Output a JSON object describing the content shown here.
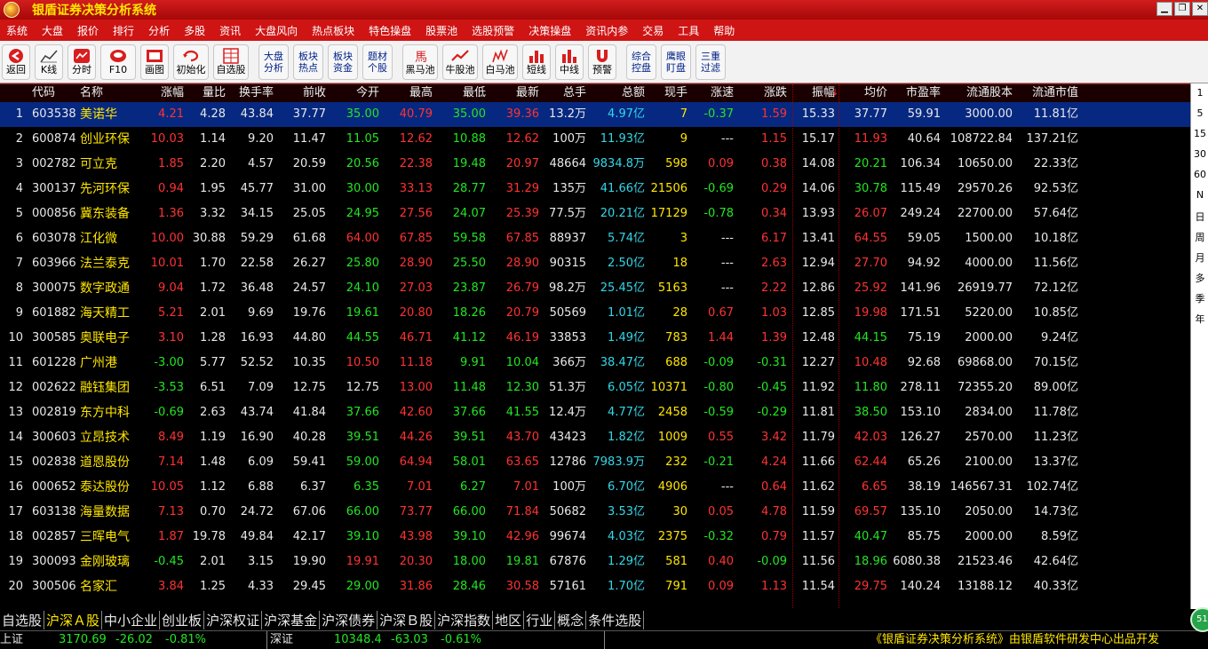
{
  "window": {
    "title": "银盾证券决策分析系统"
  },
  "menu": [
    "系统",
    "大盘",
    "报价",
    "排行",
    "分析",
    "多股",
    "资讯",
    "大盘风向",
    "热点板块",
    "特色操盘",
    "股票池",
    "选股预警",
    "决策操盘",
    "资讯内参",
    "交易",
    "工具",
    "帮助"
  ],
  "toolbar": [
    {
      "label": "返回",
      "icon": "back-icon"
    },
    {
      "label": "K线",
      "icon": "kline-icon"
    },
    {
      "label": "分时",
      "icon": "intraday-icon"
    },
    {
      "label": "F10",
      "icon": "f10-icon"
    },
    {
      "label": "画图",
      "icon": "draw-icon"
    },
    {
      "label": "初始化",
      "icon": "reset-icon"
    },
    {
      "label": "自选股",
      "icon": "watchlist-icon"
    },
    {
      "label1": "大盘",
      "label2": "分析"
    },
    {
      "label1": "板块",
      "label2": "热点"
    },
    {
      "label1": "板块",
      "label2": "资金"
    },
    {
      "label1": "题材",
      "label2": "个股"
    },
    {
      "label": "黑马池",
      "icon": "horse-icon"
    },
    {
      "label": "牛股池",
      "icon": "bull-icon"
    },
    {
      "label": "白马池",
      "icon": "whitehorse-icon"
    },
    {
      "label": "短线",
      "icon": "short-bars-icon"
    },
    {
      "label": "中线",
      "icon": "mid-bars-icon"
    },
    {
      "label": "预警",
      "icon": "alert-magnet-icon"
    },
    {
      "label1": "综合",
      "label2": "控盘"
    },
    {
      "label1": "鹰眼",
      "label2": "盯盘"
    },
    {
      "label1": "三重",
      "label2": "过滤"
    }
  ],
  "columns": [
    "代码",
    "名称",
    "涨幅",
    "量比",
    "换手率",
    "前收",
    "今开",
    "最高",
    "最低",
    "最新",
    "总手",
    "总额",
    "现手",
    "涨速",
    "涨跌",
    "振幅",
    "均价",
    "市盈率",
    "流通股本",
    "流通市值"
  ],
  "sort_indicator": "↓",
  "rows": [
    [
      "1",
      "603538",
      "美诺华",
      "4.21",
      "4.28",
      "43.84",
      "37.77",
      "35.00",
      "40.79",
      "35.00",
      "39.36",
      "13.2万",
      "4.97亿",
      "7",
      "-0.37",
      "1.59",
      "15.33",
      "37.77",
      "59.91",
      "3000.00",
      "11.81亿"
    ],
    [
      "2",
      "600874",
      "创业环保",
      "10.03",
      "1.14",
      "9.20",
      "11.47",
      "11.05",
      "12.62",
      "10.88",
      "12.62",
      "100万",
      "11.93亿",
      "9",
      "---",
      "1.15",
      "15.17",
      "11.93",
      "40.64",
      "108722.84",
      "137.21亿"
    ],
    [
      "3",
      "002782",
      "可立克",
      "1.85",
      "2.20",
      "4.57",
      "20.59",
      "20.56",
      "22.38",
      "19.48",
      "20.97",
      "48664",
      "9834.8万",
      "598",
      "0.09",
      "0.38",
      "14.08",
      "20.21",
      "106.34",
      "10650.00",
      "22.33亿"
    ],
    [
      "4",
      "300137",
      "先河环保",
      "0.94",
      "1.95",
      "45.77",
      "31.00",
      "30.00",
      "33.13",
      "28.77",
      "31.29",
      "135万",
      "41.66亿",
      "21506",
      "-0.69",
      "0.29",
      "14.06",
      "30.78",
      "115.49",
      "29570.26",
      "92.53亿"
    ],
    [
      "5",
      "000856",
      "冀东装备",
      "1.36",
      "3.32",
      "34.15",
      "25.05",
      "24.95",
      "27.56",
      "24.07",
      "25.39",
      "77.5万",
      "20.21亿",
      "17129",
      "-0.78",
      "0.34",
      "13.93",
      "26.07",
      "249.24",
      "22700.00",
      "57.64亿"
    ],
    [
      "6",
      "603078",
      "江化微",
      "10.00",
      "30.88",
      "59.29",
      "61.68",
      "64.00",
      "67.85",
      "59.58",
      "67.85",
      "88937",
      "5.74亿",
      "3",
      "---",
      "6.17",
      "13.41",
      "64.55",
      "59.05",
      "1500.00",
      "10.18亿"
    ],
    [
      "7",
      "603966",
      "法兰泰克",
      "10.01",
      "1.70",
      "22.58",
      "26.27",
      "25.80",
      "28.90",
      "25.50",
      "28.90",
      "90315",
      "2.50亿",
      "18",
      "---",
      "2.63",
      "12.94",
      "27.70",
      "94.92",
      "4000.00",
      "11.56亿"
    ],
    [
      "8",
      "300075",
      "数字政通",
      "9.04",
      "1.72",
      "36.48",
      "24.57",
      "24.10",
      "27.03",
      "23.87",
      "26.79",
      "98.2万",
      "25.45亿",
      "5163",
      "---",
      "2.22",
      "12.86",
      "25.92",
      "141.96",
      "26919.77",
      "72.12亿"
    ],
    [
      "9",
      "601882",
      "海天精工",
      "5.21",
      "2.01",
      "9.69",
      "19.76",
      "19.61",
      "20.80",
      "18.26",
      "20.79",
      "50569",
      "1.01亿",
      "28",
      "0.67",
      "1.03",
      "12.85",
      "19.98",
      "171.51",
      "5220.00",
      "10.85亿"
    ],
    [
      "10",
      "300585",
      "奥联电子",
      "3.10",
      "1.28",
      "16.93",
      "44.80",
      "44.55",
      "46.71",
      "41.12",
      "46.19",
      "33853",
      "1.49亿",
      "783",
      "1.44",
      "1.39",
      "12.48",
      "44.15",
      "75.19",
      "2000.00",
      "9.24亿"
    ],
    [
      "11",
      "601228",
      "广州港",
      "-3.00",
      "5.77",
      "52.52",
      "10.35",
      "10.50",
      "11.18",
      "9.91",
      "10.04",
      "366万",
      "38.47亿",
      "688",
      "-0.09",
      "-0.31",
      "12.27",
      "10.48",
      "92.68",
      "69868.00",
      "70.15亿"
    ],
    [
      "12",
      "002622",
      "融钰集团",
      "-3.53",
      "6.51",
      "7.09",
      "12.75",
      "12.75",
      "13.00",
      "11.48",
      "12.30",
      "51.3万",
      "6.05亿",
      "10371",
      "-0.80",
      "-0.45",
      "11.92",
      "11.80",
      "278.11",
      "72355.20",
      "89.00亿"
    ],
    [
      "13",
      "002819",
      "东方中科",
      "-0.69",
      "2.63",
      "43.74",
      "41.84",
      "37.66",
      "42.60",
      "37.66",
      "41.55",
      "12.4万",
      "4.77亿",
      "2458",
      "-0.59",
      "-0.29",
      "11.81",
      "38.50",
      "153.10",
      "2834.00",
      "11.78亿"
    ],
    [
      "14",
      "300603",
      "立昂技术",
      "8.49",
      "1.19",
      "16.90",
      "40.28",
      "39.51",
      "44.26",
      "39.51",
      "43.70",
      "43423",
      "1.82亿",
      "1009",
      "0.55",
      "3.42",
      "11.79",
      "42.03",
      "126.27",
      "2570.00",
      "11.23亿"
    ],
    [
      "15",
      "002838",
      "道恩股份",
      "7.14",
      "1.48",
      "6.09",
      "59.41",
      "59.00",
      "64.94",
      "58.01",
      "63.65",
      "12786",
      "7983.9万",
      "232",
      "-0.21",
      "4.24",
      "11.66",
      "62.44",
      "65.26",
      "2100.00",
      "13.37亿"
    ],
    [
      "16",
      "000652",
      "泰达股份",
      "10.05",
      "1.12",
      "6.88",
      "6.37",
      "6.35",
      "7.01",
      "6.27",
      "7.01",
      "100万",
      "6.70亿",
      "4906",
      "---",
      "0.64",
      "11.62",
      "6.65",
      "38.19",
      "146567.31",
      "102.74亿"
    ],
    [
      "17",
      "603138",
      "海量数据",
      "7.13",
      "0.70",
      "24.72",
      "67.06",
      "66.00",
      "73.77",
      "66.00",
      "71.84",
      "50682",
      "3.53亿",
      "30",
      "0.05",
      "4.78",
      "11.59",
      "69.57",
      "135.10",
      "2050.00",
      "14.73亿"
    ],
    [
      "18",
      "002857",
      "三晖电气",
      "1.87",
      "19.78",
      "49.84",
      "42.17",
      "39.10",
      "43.98",
      "39.10",
      "42.96",
      "99674",
      "4.03亿",
      "2375",
      "-0.32",
      "0.79",
      "11.57",
      "40.47",
      "85.75",
      "2000.00",
      "8.59亿"
    ],
    [
      "19",
      "300093",
      "金刚玻璃",
      "-0.45",
      "2.01",
      "3.15",
      "19.90",
      "19.91",
      "20.30",
      "18.00",
      "19.81",
      "67876",
      "1.29亿",
      "581",
      "0.40",
      "-0.09",
      "11.56",
      "18.96",
      "6080.38",
      "21523.46",
      "42.64亿"
    ],
    [
      "20",
      "300506",
      "名家汇",
      "3.84",
      "1.25",
      "4.33",
      "29.45",
      "29.00",
      "31.86",
      "28.46",
      "30.58",
      "57161",
      "1.70亿",
      "791",
      "0.09",
      "1.13",
      "11.54",
      "29.75",
      "140.24",
      "13188.12",
      "40.33亿"
    ]
  ],
  "period_buttons": [
    "1",
    "5",
    "15",
    "30",
    "60",
    "N",
    "日",
    "周",
    "月",
    "多",
    "季",
    "年"
  ],
  "bottom_tabs": [
    "自选股",
    "沪深Ａ股",
    "中小企业",
    "创业板",
    "沪深权证",
    "沪深基金",
    "沪深债券",
    "沪深Ｂ股",
    "沪深指数",
    "地区",
    "行业",
    "概念",
    "条件选股"
  ],
  "active_tab": 1,
  "status": {
    "sh_label": "上证",
    "sh_value": "3170.69",
    "sh_change": "-26.02",
    "sh_pct": "-0.81%",
    "sz_label": "深证",
    "sz_value": "10348.4",
    "sz_change": "-63.03",
    "sz_pct": "-0.61%",
    "ticker": "《银盾证券决策分析系统》由银盾软件研发中心出品开发"
  },
  "badge": "51",
  "colors": {
    "up": "#ff3232",
    "down": "#22e622",
    "flat": "#e8e8e8",
    "name": "#ffe600",
    "amount": "#33d7e8",
    "selected_row": "#062880"
  }
}
